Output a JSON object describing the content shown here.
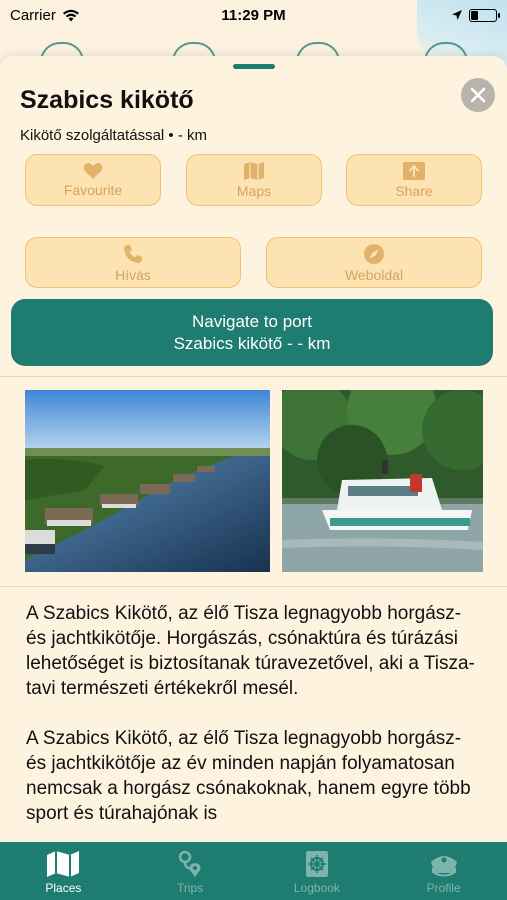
{
  "status_bar": {
    "carrier": "Carrier",
    "time": "11:29 PM",
    "battery_level": 0.25
  },
  "place": {
    "title": "Szabics kikötő",
    "subtitle": "Kikötő szolgáltatással  • - km"
  },
  "actions": {
    "favourite": "Favourite",
    "maps": "Maps",
    "share": "Share",
    "call": "Hívás",
    "website": "Weboldal"
  },
  "navigate": {
    "line1": "Navigate to port",
    "line2": "Szabics kikötő - - km"
  },
  "description": {
    "paragraph1": "A Szabics Kikötő, az élő Tisza legnagyobb horgász- és jachtkikötője. Horgászás, csónaktúra és túrázási lehetőséget is biztosítanak túravezetővel, aki a Tisza-tavi természeti értékekről mesél.",
    "paragraph2": "A Szabics Kikötő, az élő Tisza legnagyobb horgász- és jachtkikötője az év minden napján folyamatosan nemcsak a horgász csónakoknak, hanem egyre több sport és túrahajónak is"
  },
  "tabs": [
    {
      "label": "Places",
      "icon": "map-icon",
      "active": true
    },
    {
      "label": "Trips",
      "icon": "route-pin-icon",
      "active": false
    },
    {
      "label": "Logbook",
      "icon": "ship-wheel-book-icon",
      "active": false
    },
    {
      "label": "Profile",
      "icon": "captain-hat-icon",
      "active": false
    }
  ],
  "colors": {
    "accent": "#1f7c70",
    "sheet_bg": "#fdf3df",
    "button_bg": "#fde2b2",
    "button_border": "#f2c174",
    "button_text": "#d2a55e"
  }
}
